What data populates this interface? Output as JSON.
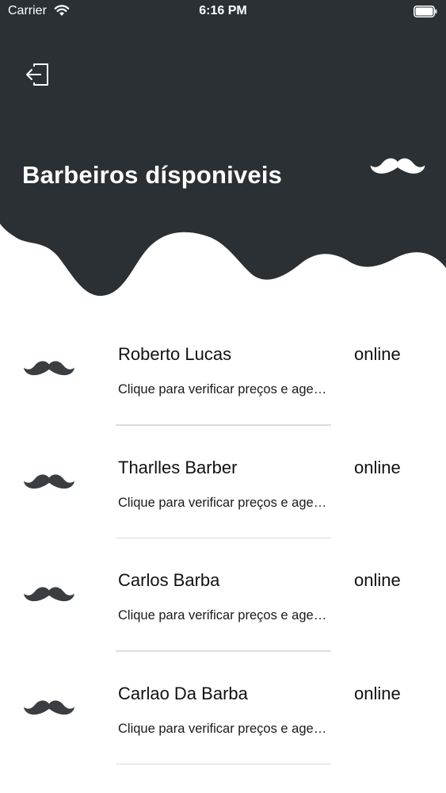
{
  "colors": {
    "header_bg": "#2b3034",
    "text_light": "#ffffff",
    "text_dark": "#111111",
    "divider": "#dcdcdc",
    "mustache_dark": "#3a3e42"
  },
  "status_bar": {
    "carrier": "Carrier",
    "time": "6:16 PM",
    "icons": [
      "wifi-icon",
      "battery-icon"
    ]
  },
  "header": {
    "logout_icon": "logout-icon",
    "title": "Barbeiros dísponiveis",
    "logo_icon": "mustache-icon"
  },
  "barbers": [
    {
      "name": "Roberto Lucas",
      "status": "online",
      "subtitle": "Clique para verificar preços e agendar"
    },
    {
      "name": "Tharlles Barber",
      "status": "online",
      "subtitle": "Clique para verificar preços e agendar"
    },
    {
      "name": "Carlos Barba",
      "status": "online",
      "subtitle": "Clique para verificar preços e agendar"
    },
    {
      "name": "Carlao Da Barba",
      "status": "online",
      "subtitle": "Clique para verificar preços e agendar"
    }
  ]
}
